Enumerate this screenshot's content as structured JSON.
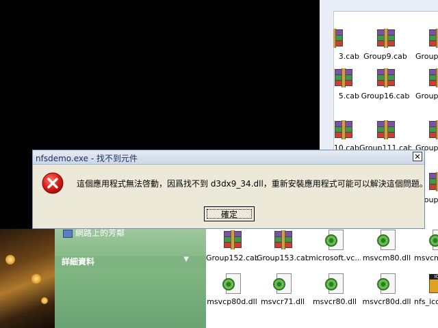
{
  "dialog": {
    "title": "nfsdemo.exe - 找不到元件",
    "message": "這個應用程式無法啓動，因爲找不到 d3dx9_34.dll，重新安裝應用程式可能可以解決這個問題。",
    "ok_label": "確定",
    "close_glyph": "✕",
    "icon": "error-icon"
  },
  "tasks_pane": {
    "partial_item": "網路上的芳鄰",
    "details_header": "詳細資料",
    "chevron": "▼"
  },
  "explorer_top_files": [
    {
      "label": "3.cab",
      "icon": "rar-archive-icon"
    },
    {
      "label": "Group9.cab",
      "icon": "rar-archive-icon"
    },
    {
      "label": "Group1",
      "icon": "rar-archive-icon"
    },
    {
      "label": "5.cab",
      "icon": "rar-archive-icon"
    },
    {
      "label": "Group16.cab",
      "icon": "rar-archive-icon"
    },
    {
      "label": "Group1",
      "icon": "rar-archive-icon"
    },
    {
      "label": "10.cab",
      "icon": "rar-archive-icon"
    },
    {
      "label": "Group111.cab",
      "icon": "rar-archive-icon"
    },
    {
      "label": "Group1",
      "icon": "rar-archive-icon"
    }
  ],
  "files_row1": [
    {
      "label": "Group152.cab",
      "icon": "rar-archive-icon"
    },
    {
      "label": "Group153.cab",
      "icon": "rar-archive-icon"
    },
    {
      "label": "microsoft.vc...",
      "icon": "dll-file-icon"
    },
    {
      "label": "msvcm80.dll",
      "icon": "dll-file-icon"
    },
    {
      "label": "msvcm8",
      "icon": "dll-file-icon"
    }
  ],
  "files_row2": [
    {
      "label": "msvcp80d.dll",
      "icon": "dll-file-icon"
    },
    {
      "label": "msvcr71.dll",
      "icon": "dll-file-icon"
    },
    {
      "label": "msvcr80.dll",
      "icon": "dll-file-icon"
    },
    {
      "label": "msvcr80d.dll",
      "icon": "dll-file-icon"
    },
    {
      "label": "nfs_ico",
      "icon": "nfs-ico-file-icon"
    }
  ],
  "explorer_right_partial": {
    "label": "Group1"
  }
}
